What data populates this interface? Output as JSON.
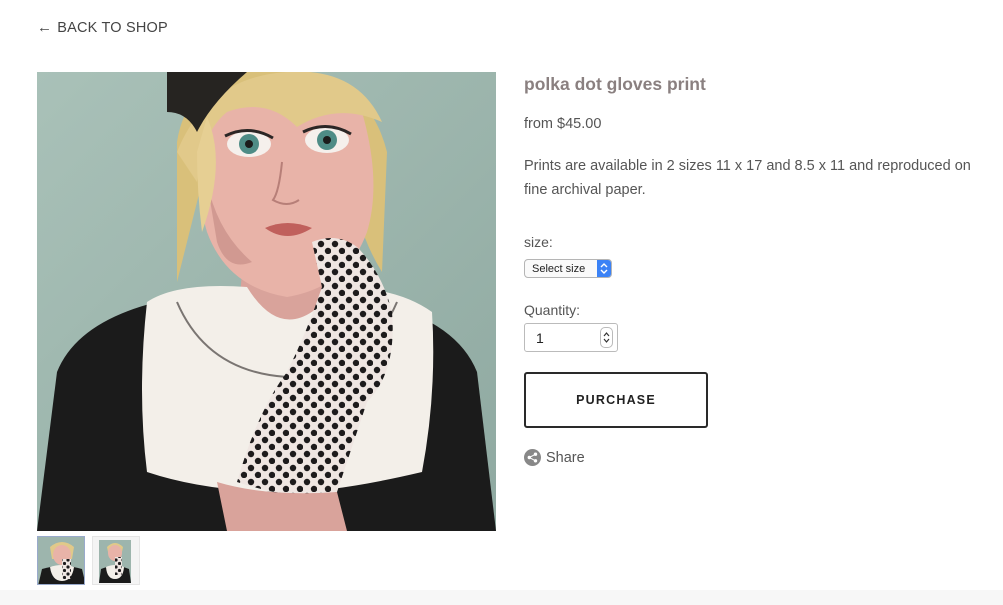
{
  "nav": {
    "back_arrow": "←",
    "back_label": "BACK TO SHOP"
  },
  "product": {
    "title": "polka dot gloves print",
    "price": "from $45.00",
    "description": "Prints are available in 2 sizes 11 x 17 and 8.5 x 11 and reproduced on fine archival paper.",
    "image_alt": "Painting of a blonde girl with polka dot gloves"
  },
  "options": {
    "size_label": "size:",
    "size_selected": "Select size",
    "quantity_label": "Quantity:",
    "quantity_value": "1"
  },
  "actions": {
    "purchase_label": "PURCHASE",
    "share_label": "Share"
  },
  "icons": {
    "back": "arrow-left-icon",
    "share": "share-icon",
    "select": "chevron-updown-icon",
    "stepper": "stepper-icon"
  },
  "colors": {
    "title": "#8a8080",
    "text": "#555555",
    "button_border": "#2a2a2a",
    "select_accent": "#3b82f6",
    "painting_bg": "#9db5ad"
  }
}
